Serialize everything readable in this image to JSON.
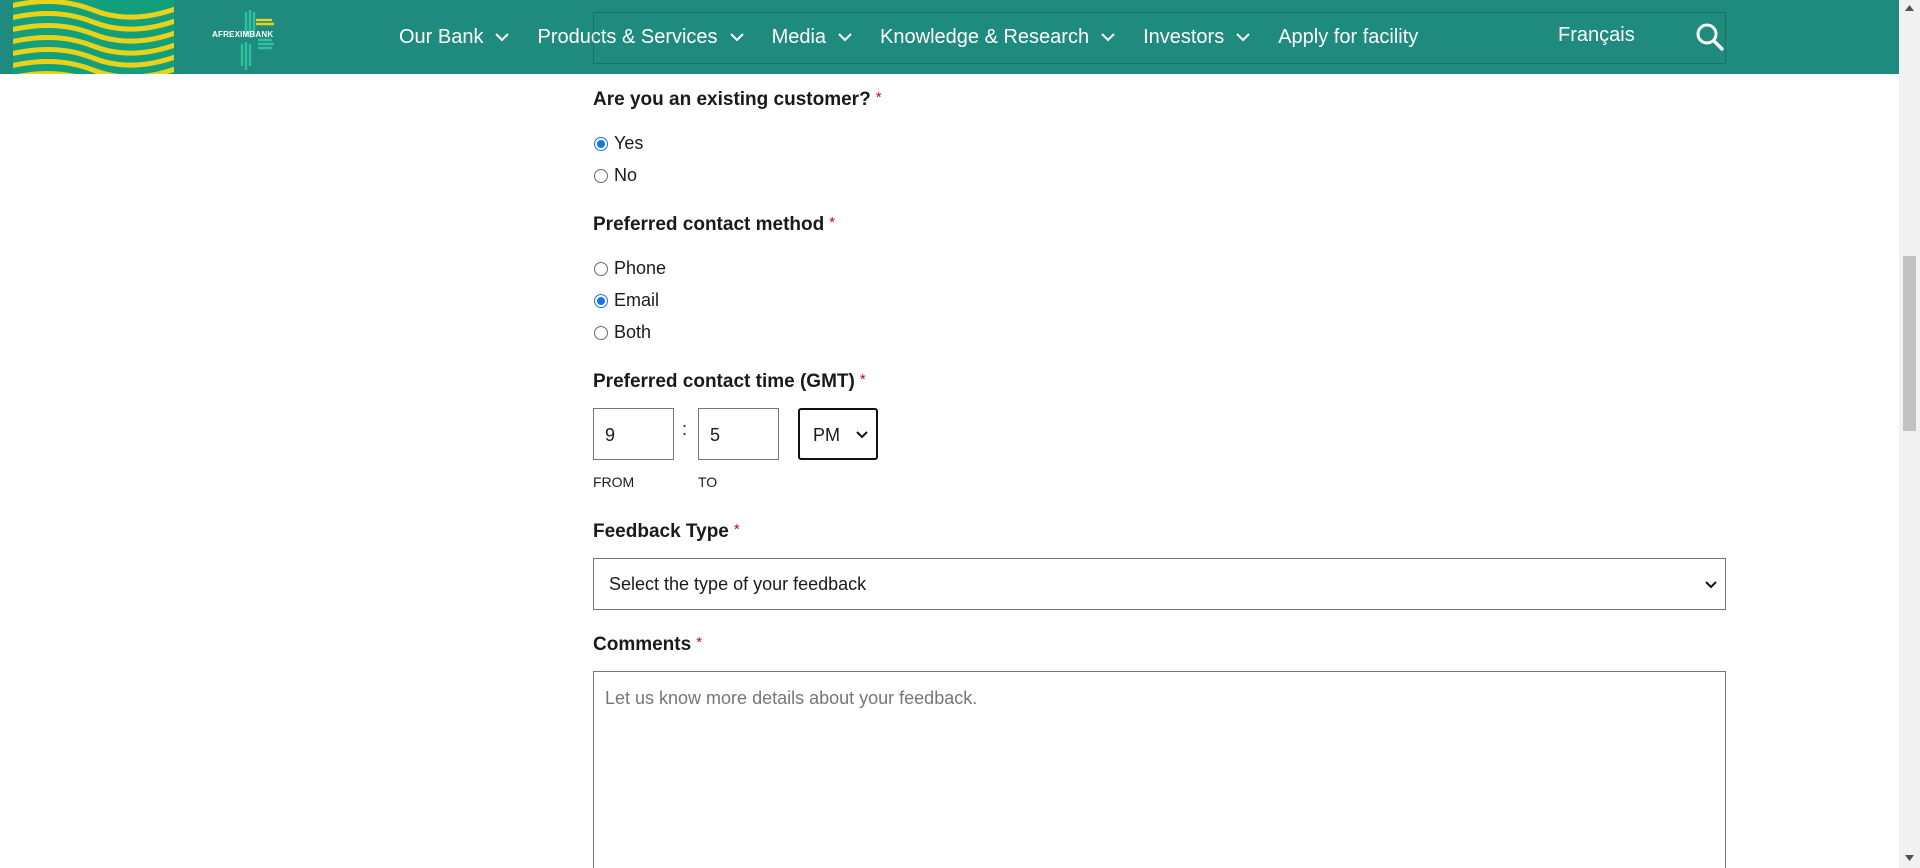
{
  "header": {
    "logo_text": "AFREXIMBANK",
    "nav": [
      {
        "label": "Our Bank",
        "has_dropdown": true
      },
      {
        "label": "Products & Services",
        "has_dropdown": true
      },
      {
        "label": "Media",
        "has_dropdown": true
      },
      {
        "label": "Knowledge & Research",
        "has_dropdown": true
      },
      {
        "label": "Investors",
        "has_dropdown": true
      },
      {
        "label": "Apply for facility",
        "has_dropdown": false
      }
    ],
    "language": "Français",
    "search_icon": "search-icon"
  },
  "form": {
    "existing_customer": {
      "label": "Are you an existing customer?",
      "required": "*",
      "options": [
        {
          "label": "Yes",
          "checked": true
        },
        {
          "label": "No",
          "checked": false
        }
      ]
    },
    "contact_method": {
      "label": "Preferred contact method",
      "required": "*",
      "options": [
        {
          "label": "Phone",
          "checked": false
        },
        {
          "label": "Email",
          "checked": true
        },
        {
          "label": "Both",
          "checked": false
        }
      ]
    },
    "contact_time": {
      "label": "Preferred contact time (GMT)",
      "required": "*",
      "from_value": "9",
      "separator": ":",
      "to_value": "5",
      "ampm_value": "PM",
      "from_label": "FROM",
      "to_label": "TO"
    },
    "feedback_type": {
      "label": "Feedback Type",
      "required": "*",
      "selected": "Select the type of your feedback"
    },
    "comments": {
      "label": "Comments",
      "required": "*",
      "placeholder": "Let us know more details about your feedback."
    }
  },
  "colors": {
    "header_bg": "#1f8a7e",
    "radio_checked": "#1a73e8",
    "required_star": "#d0021b"
  }
}
